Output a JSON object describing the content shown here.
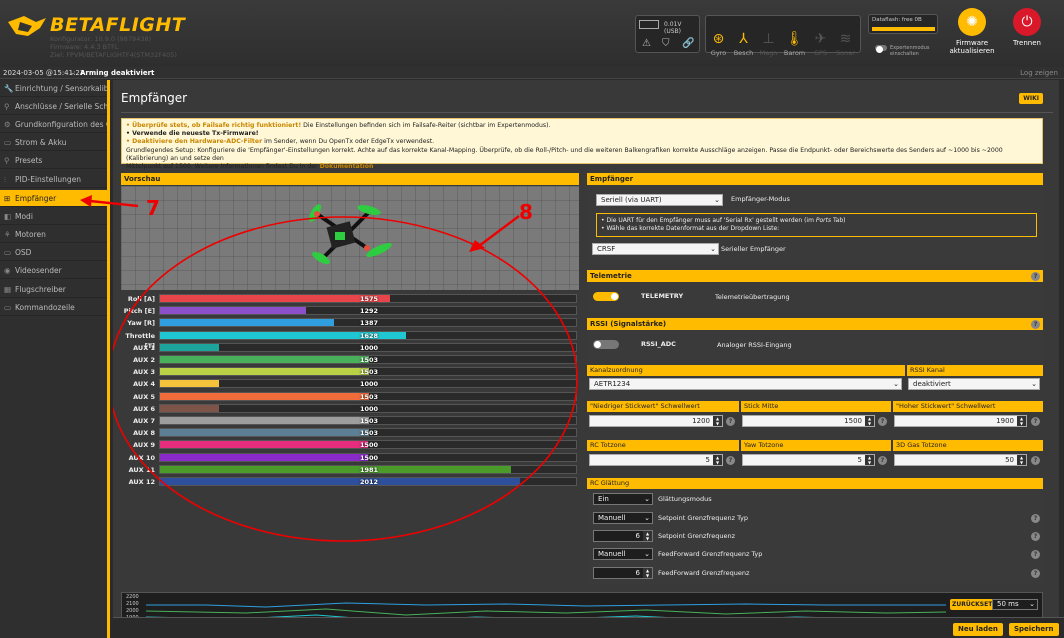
{
  "header": {
    "logo_text": "BETAFLIGHT",
    "configurator": "Konfigurator: 10.9.0 (9879438)",
    "firmware": "Firmware: 4.4.3 BTFL",
    "target": "Ziel: FPVM/BETAFLIGHTF4(STM32F405)",
    "battery": "0.01V (USB)",
    "dataflash": "Dataflash: free 0B",
    "expert_mode": "Expertenmodus einschalten",
    "firmware_update": "Firmware aktualisieren",
    "disconnect": "Trennen",
    "sensors": [
      {
        "label": "Gyro",
        "icon": "gyro-icon",
        "active": true
      },
      {
        "label": "Besch",
        "icon": "accel-icon",
        "active": true
      },
      {
        "label": "Magn",
        "icon": "mag-icon",
        "active": false
      },
      {
        "label": "Barom",
        "icon": "baro-icon",
        "active": true
      },
      {
        "label": "GPS",
        "icon": "gps-icon",
        "active": false
      },
      {
        "label": "Sonar",
        "icon": "sonar-icon",
        "active": false
      }
    ]
  },
  "status_bar": {
    "datetime": "2024-03-05 @15:41:27",
    "arming": "Arming deaktiviert",
    "log": "Log zeigen"
  },
  "sidebar": {
    "items": [
      {
        "label": "Einrichtung / Sensorkalibr...",
        "icon": "wrench-icon"
      },
      {
        "label": "Anschlüsse / Serielle Schn...",
        "icon": "plug-icon"
      },
      {
        "label": "Grundkonfiguration des C...",
        "icon": "gear-icon"
      },
      {
        "label": "Strom & Akku",
        "icon": "battery-icon"
      },
      {
        "label": "Presets",
        "icon": "presets-icon"
      },
      {
        "label": "PID-Einstellungen",
        "icon": "pid-icon"
      },
      {
        "label": "Empfänger",
        "icon": "receiver-icon",
        "active": true
      },
      {
        "label": "Modi",
        "icon": "modes-icon"
      },
      {
        "label": "Motoren",
        "icon": "motor-icon"
      },
      {
        "label": "OSD",
        "icon": "osd-icon"
      },
      {
        "label": "Videosender",
        "icon": "vtx-icon"
      },
      {
        "label": "Flugschreiber",
        "icon": "blackbox-icon"
      },
      {
        "label": "Kommandozeile",
        "icon": "cli-icon"
      }
    ]
  },
  "page": {
    "title": "Empfänger",
    "wiki": "WIKI",
    "notes": {
      "l1_b": "• Überprüfe stets, ob Failsafe richtig funktioniert!",
      "l1_r": " Die Einstellungen befinden sich im Failsafe-Reiter (sichtbar im Expertenmodus).",
      "l2_b": "• Verwende die neueste Tx-Firmware!",
      "l3_b": "• Deaktiviere den Hardware-ADC-Filter",
      "l3_r": " im Sender, wenn Du OpenTx oder EdgeTx verwendest.",
      "l4": "Grundlegendes Setup: Konfiguriere die 'Empfänger'-Einstellungen korrekt. Achte auf das korrekte Kanal-Mapping. Überprüfe, ob die Roll-/Pitch- und die weiteren Balkengrafiken korrekte Ausschläge anzeigen. Passe die Endpunkt- oder Bereichswerte des Senders auf ~1000 bis ~2000 (Kalibrierung) an und setze den",
      "l5": "Mittelpunkt auf 1500. Weitere Informationen findest Du in der ",
      "l5_link": "Dokumentation",
      "l5_end": "."
    }
  },
  "preview": {
    "title": "Vorschau"
  },
  "channels": [
    {
      "label": "Roll [A]",
      "value": 1575,
      "color": "#e8454b"
    },
    {
      "label": "Pitch [E]",
      "value": 1292,
      "color": "#8a4fc9"
    },
    {
      "label": "Yaw [R]",
      "value": 1387,
      "color": "#2f9fe0"
    },
    {
      "label": "Throttle [T]",
      "value": 1628,
      "color": "#1ec7d2"
    },
    {
      "label": "AUX 1",
      "value": 1000,
      "color": "#1ba39c"
    },
    {
      "label": "AUX 2",
      "value": 1503,
      "color": "#48b05a"
    },
    {
      "label": "AUX 3",
      "value": 1503,
      "color": "#b9d245"
    },
    {
      "label": "AUX 4",
      "value": 1000,
      "color": "#f5c33b"
    },
    {
      "label": "AUX 5",
      "value": 1503,
      "color": "#f26b3a"
    },
    {
      "label": "AUX 6",
      "value": 1000,
      "color": "#7d5548"
    },
    {
      "label": "AUX 7",
      "value": 1503,
      "color": "#9e9e9e"
    },
    {
      "label": "AUX 8",
      "value": 1503,
      "color": "#5c7f95"
    },
    {
      "label": "AUX 9",
      "value": 1500,
      "color": "#e52c7d"
    },
    {
      "label": "AUX 10",
      "value": 1500,
      "color": "#8a2bc9"
    },
    {
      "label": "AUX 11",
      "value": 1981,
      "color": "#4a9b2a"
    },
    {
      "label": "AUX 12",
      "value": 2012,
      "color": "#2d4f9c"
    }
  ],
  "receiver": {
    "title": "Empfänger",
    "mode_value": "Seriell (via UART)",
    "mode_label": "Empfänger-Modus",
    "info1": "• Die UART für den Empfänger muss auf 'Serial Rx' gestellt werden (im ",
    "info1_em": "Ports",
    "info1_end": " Tab)",
    "info2": "• Wähle das korrekte Datenformat aus der Dropdown Liste:",
    "serial_value": "CRSF",
    "serial_label": "Serieller Empfänger"
  },
  "telemetry": {
    "title": "Telemetrie",
    "toggle_label": "TELEMETRY",
    "description": "Telemetrieübertragung",
    "enabled": true
  },
  "rssi": {
    "title": "RSSI (Signalstärke)",
    "toggle_label": "RSSI_ADC",
    "description": "Analoger RSSI-Eingang",
    "enabled": false
  },
  "mapping": {
    "title": "Kanalzuordnung",
    "value": "AETR1234",
    "rssi_channel_title": "RSSI Kanal",
    "rssi_channel_value": "deaktiviert"
  },
  "sticks": {
    "low_title": "\"Niedriger Stickwert\" Schwellwert",
    "low_value": "1200",
    "center_title": "Stick Mitte",
    "center_value": "1500",
    "high_title": "\"Hoher Stickwert\" Schwellwert",
    "high_value": "1900"
  },
  "deadband": {
    "rc_title": "RC Totzone",
    "rc_value": "5",
    "yaw_title": "Yaw Totzone",
    "yaw_value": "5",
    "gas_title": "3D Gas Totzone",
    "gas_value": "50"
  },
  "smoothing": {
    "title": "RC Glättung",
    "mode_value": "Ein",
    "mode_label": "Glättungsmodus",
    "sp_type_value": "Manuell",
    "sp_type_label": "Setpoint Grenzfrequenz Typ",
    "sp_value": "6",
    "sp_label": "Setpoint Grenzfrequenz",
    "ff_type_value": "Manuell",
    "ff_type_label": "FeedForward Grenzfrequenz Typ",
    "ff_value": "6",
    "ff_label": "FeedForward Grenzfrequenz"
  },
  "graph": {
    "ticks": [
      "2200",
      "2100",
      "2000",
      "1900"
    ],
    "reset": "ZURÜCKSETZ",
    "interval": "50 ms"
  },
  "footer": {
    "refresh": "Neu laden",
    "save": "Speichern"
  },
  "annotations": {
    "arrow7": "7",
    "arrow8": "8",
    "color": "#e00000"
  }
}
